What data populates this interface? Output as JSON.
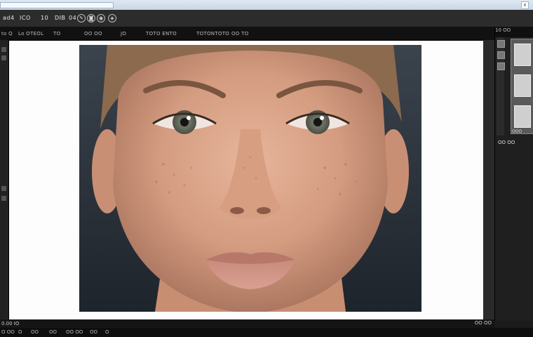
{
  "titlebar": {
    "address": "",
    "close": "x"
  },
  "menubar": {
    "items": [
      {
        "label": "ad4"
      },
      {
        "label": "ICO"
      },
      {
        "label": "10"
      },
      {
        "label": "DIB"
      },
      {
        "label": "04"
      }
    ],
    "icons": [
      "brush-icon",
      "camera-icon",
      "eye-icon",
      "layers-icon"
    ]
  },
  "options": [
    {
      "label": "to Q"
    },
    {
      "label": "Lo OTEOL"
    },
    {
      "label": "TO"
    },
    {
      "label": "OO OO"
    },
    {
      "label": "JO"
    },
    {
      "label": "TOTO ENTO"
    },
    {
      "label": "TOTONTOTO"
    },
    {
      "label": "OO TO"
    }
  ],
  "right_panel": {
    "header": "10 OO",
    "label": "OOO",
    "row": "OO OO"
  },
  "status": {
    "left": "0.00 IO",
    "right": "OO OO"
  },
  "bottom": {
    "items": [
      "O OO",
      "O",
      "OO",
      "OO",
      "OO OO",
      "OO",
      "O"
    ]
  }
}
